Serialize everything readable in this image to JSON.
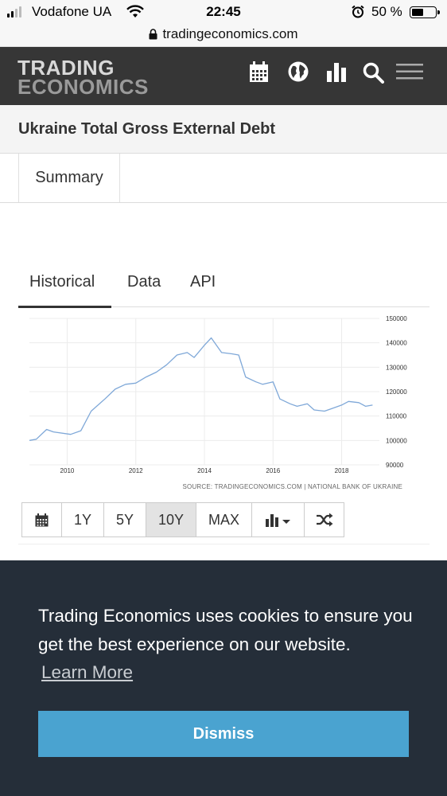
{
  "status_bar": {
    "carrier": "Vodafone UA",
    "time": "22:45",
    "battery": "50 %",
    "battery_level": 0.5
  },
  "url_bar": {
    "url": "tradingeconomics.com"
  },
  "header": {
    "logo_line1": "TRADING",
    "logo_line2": "ECONOMICS",
    "icons": [
      "calendar-icon",
      "globe-icon",
      "bar-chart-icon",
      "search-icon",
      "hamburger-menu-icon"
    ]
  },
  "page": {
    "title": "Ukraine Total Gross External Debt",
    "summary_tab": "Summary"
  },
  "chart_tabs": {
    "items": [
      "Historical",
      "Data",
      "API"
    ],
    "active": "Historical"
  },
  "chart_data": {
    "type": "line",
    "title": "",
    "xlabel": "",
    "ylabel": "",
    "x_ticks": [
      "2010",
      "2012",
      "2014",
      "2016",
      "2018"
    ],
    "y_ticks": [
      "150000",
      "140000",
      "130000",
      "120000",
      "110000",
      "100000",
      "90000"
    ],
    "xlim": [
      2008.9,
      2019.1
    ],
    "ylim": [
      90000,
      150000
    ],
    "grid": true,
    "line_color": "#7fa8d8",
    "series": [
      {
        "x": [
          2008.9,
          2009.1,
          2009.4,
          2009.6,
          2010.1,
          2010.4,
          2010.7,
          2011.1,
          2011.4,
          2011.7,
          2012.0,
          2012.3,
          2012.6,
          2012.9,
          2013.2,
          2013.5,
          2013.7,
          2014.0,
          2014.2,
          2014.5,
          2014.8,
          2015.0,
          2015.2,
          2015.5,
          2015.7,
          2016.0,
          2016.2,
          2016.5,
          2016.7,
          2017.0,
          2017.2,
          2017.5,
          2017.7,
          2018.0,
          2018.2,
          2018.5,
          2018.7,
          2018.9
        ],
        "y": [
          100000,
          100500,
          104500,
          103500,
          102500,
          104000,
          112000,
          117000,
          121000,
          123000,
          123500,
          126000,
          128000,
          131000,
          135000,
          136000,
          134000,
          139000,
          142000,
          136000,
          135500,
          135000,
          126000,
          124000,
          123000,
          124000,
          117000,
          115000,
          114000,
          115000,
          112500,
          112000,
          113000,
          114500,
          116000,
          115500,
          114000,
          114500
        ]
      }
    ],
    "source": "SOURCE: TRADINGECONOMICS.COM | NATIONAL BANK OF UKRAINE"
  },
  "range_buttons": {
    "calendar_icon": "calendar-icon",
    "items": [
      "1Y",
      "5Y",
      "10Y",
      "MAX"
    ],
    "active": "10Y",
    "chart_type_icon": "bar-chart-dropdown-icon",
    "shuffle_icon": "shuffle-icon"
  },
  "cookie_banner": {
    "message": "Trading Economics uses cookies to ensure you get the best experience on our website.",
    "learn_more": "Learn More",
    "dismiss": "Dismiss",
    "background": "#252e39",
    "button_color": "#4aa3d0"
  }
}
